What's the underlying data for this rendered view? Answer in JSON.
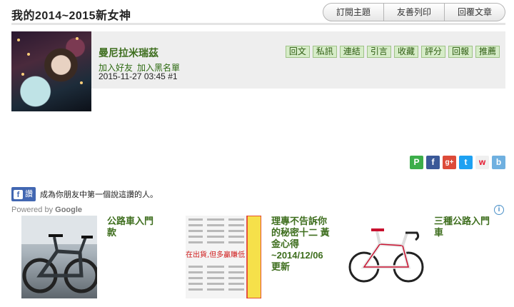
{
  "page": {
    "title": "我的2014~2015新女神"
  },
  "topbar": {
    "buttons": [
      "訂閱主題",
      "友善列印",
      "回覆文章"
    ]
  },
  "post": {
    "author": "曼尼拉米瑞茲",
    "links": [
      "加入好友",
      "加入黑名單"
    ],
    "meta": "2015-11-27 03:45  #1",
    "actions": [
      "回文",
      "私訊",
      "連結",
      "引言",
      "收藏",
      "評分",
      "回報",
      "推薦"
    ]
  },
  "share": [
    {
      "name": "plurk-icon",
      "glyph": "P",
      "color": "#3cae4a"
    },
    {
      "name": "facebook-icon",
      "glyph": "f",
      "color": "#3b5998"
    },
    {
      "name": "google-plus-icon",
      "glyph": "g+",
      "color": "#dd4b39"
    },
    {
      "name": "twitter-icon",
      "glyph": "t",
      "color": "#1da1f2"
    },
    {
      "name": "weibo-icon",
      "glyph": "w",
      "color": "#f0f0f0"
    },
    {
      "name": "blog-icon",
      "glyph": "b",
      "color": "#6fb0e0"
    }
  ],
  "facebook": {
    "button_glyph": "f",
    "button_label": "讚",
    "social_text": "成為你朋友中第一個說這讚的人。"
  },
  "ads": {
    "powered_prefix": "Powered by",
    "powered_brand": "Google",
    "info_glyph": "i",
    "items": [
      {
        "caption": "公路車入門款"
      },
      {
        "caption": "理專不告訴你的秘密十二 黃金心得~2014/12/06更新",
        "thumb_text": "在出貨,但多贏賺低"
      },
      {
        "caption": "三種公路入門車"
      }
    ]
  }
}
